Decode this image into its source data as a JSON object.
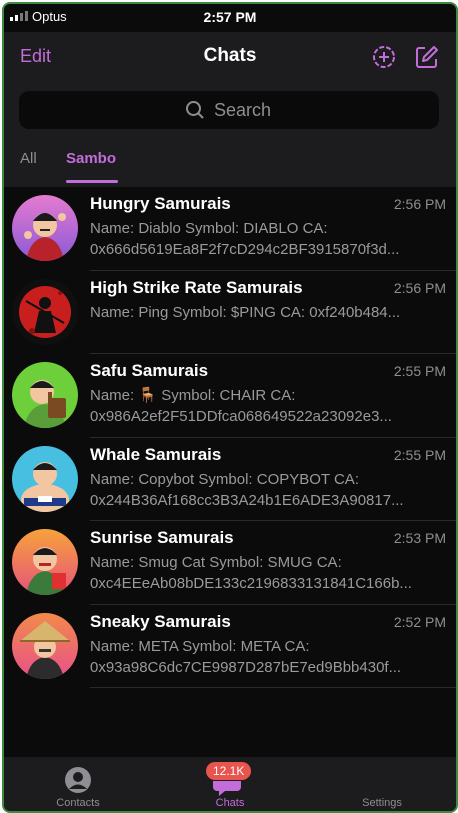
{
  "status_bar": {
    "carrier": "Optus",
    "time": "2:57 PM"
  },
  "header": {
    "edit_label": "Edit",
    "title": "Chats"
  },
  "search": {
    "placeholder": "Search"
  },
  "folders": [
    {
      "label": "All",
      "active": false
    },
    {
      "label": "Sambo",
      "active": true
    }
  ],
  "accent_color": "#c36ddb",
  "chats": [
    {
      "name": "Hungry Samurais",
      "time": "2:56 PM",
      "line1": "Name: Diablo Symbol: DIABLO CA:",
      "line2": "0x666d5619Ea8F2f7cD294c2BF3915870f3d..."
    },
    {
      "name": "High Strike Rate Samurais",
      "time": "2:56 PM",
      "line1": "Name: Ping Symbol: $PING CA: 0xf240b484...",
      "line2": ""
    },
    {
      "name": "Safu Samurais",
      "time": "2:55 PM",
      "line1": "Name: 🪑 Symbol: CHAIR CA:",
      "line2": "0x986A2ef2F51DDfca068649522a23092e3..."
    },
    {
      "name": "Whale Samurais",
      "time": "2:55 PM",
      "line1": "Name: Copybot Symbol: COPYBOT CA:",
      "line2": "0x244B36Af168cc3B3A24b1E6ADE3A90817..."
    },
    {
      "name": "Sunrise Samurais",
      "time": "2:53 PM",
      "line1": "Name: Smug Cat Symbol: SMUG CA:",
      "line2": "0xc4EEeAb08bDE133c2196833131841C166b..."
    },
    {
      "name": "Sneaky Samurais",
      "time": "2:52 PM",
      "line1": "Name: META Symbol: META CA:",
      "line2": "0x93a98C6dc7CE9987D287bE7ed9Bbb430f..."
    }
  ],
  "tab_bar": {
    "contacts_label": "Contacts",
    "chats_label": "Chats",
    "chats_badge": "12.1K",
    "settings_label": "Settings"
  }
}
